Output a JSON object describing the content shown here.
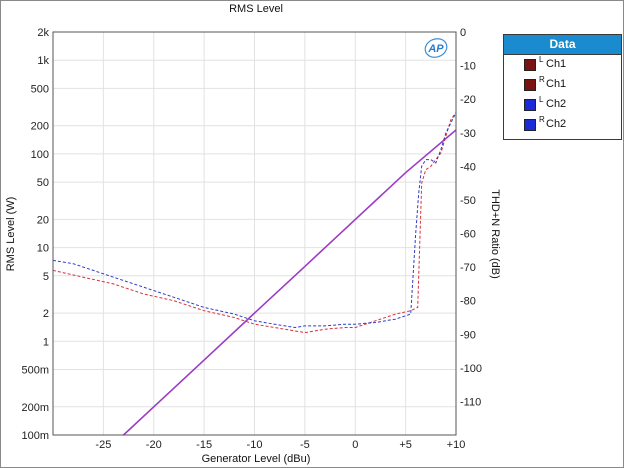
{
  "chart_data": {
    "type": "line",
    "title": "RMS Level",
    "xlabel": "Generator Level (dBu)",
    "ylabel": "RMS Level (W)",
    "y2label": "THD+N Ratio (dB)",
    "xlim": [
      -30,
      10
    ],
    "ylim": [
      0.1,
      2000
    ],
    "yscale": "log",
    "y2lim": [
      -120,
      0
    ],
    "x_ticks": [
      {
        "v": -25,
        "label": "-25"
      },
      {
        "v": -20,
        "label": "-20"
      },
      {
        "v": -15,
        "label": "-15"
      },
      {
        "v": -10,
        "label": "-10"
      },
      {
        "v": -5,
        "label": "-5"
      },
      {
        "v": 0,
        "label": "0"
      },
      {
        "v": 5,
        "label": "+5"
      },
      {
        "v": 10,
        "label": "+10"
      }
    ],
    "y_ticks": [
      {
        "v": 2000,
        "label": "2k"
      },
      {
        "v": 1000,
        "label": "1k"
      },
      {
        "v": 500,
        "label": "500"
      },
      {
        "v": 200,
        "label": "200"
      },
      {
        "v": 100,
        "label": "100"
      },
      {
        "v": 50,
        "label": "50"
      },
      {
        "v": 20,
        "label": "20"
      },
      {
        "v": 10,
        "label": "10"
      },
      {
        "v": 5,
        "label": "5"
      },
      {
        "v": 2,
        "label": "2"
      },
      {
        "v": 1,
        "label": "1"
      },
      {
        "v": 0.5,
        "label": "500m"
      },
      {
        "v": 0.2,
        "label": "200m"
      },
      {
        "v": 0.1,
        "label": "100m"
      }
    ],
    "y2_ticks": [
      {
        "v": 0,
        "label": "0"
      },
      {
        "v": -10,
        "label": "-10"
      },
      {
        "v": -20,
        "label": "-20"
      },
      {
        "v": -30,
        "label": "-30"
      },
      {
        "v": -40,
        "label": "-40"
      },
      {
        "v": -50,
        "label": "-50"
      },
      {
        "v": -60,
        "label": "-60"
      },
      {
        "v": -70,
        "label": "-70"
      },
      {
        "v": -80,
        "label": "-80"
      },
      {
        "v": -90,
        "label": "-90"
      },
      {
        "v": -100,
        "label": "-100"
      },
      {
        "v": -110,
        "label": "-110"
      }
    ],
    "grid": true,
    "legend": {
      "title": "Data",
      "position": "right",
      "items": [
        {
          "sup": "L",
          "name": "Ch1",
          "color": "#7a1212"
        },
        {
          "sup": "R",
          "name": "Ch1",
          "color": "#7a1212"
        },
        {
          "sup": "L",
          "name": "Ch2",
          "color": "#1a2ad8"
        },
        {
          "sup": "R",
          "name": "Ch2",
          "color": "#1a2ad8"
        }
      ]
    },
    "logo": "AP",
    "series": [
      {
        "axis": "left",
        "style": "solid",
        "color": "#9a3cc4",
        "x": [
          -23,
          -20,
          -15,
          -10,
          -5,
          0,
          5,
          10
        ],
        "y": [
          0.1,
          0.2,
          0.63,
          2.0,
          6.3,
          20,
          63,
          180
        ]
      },
      {
        "axis": "right",
        "style": "dashed",
        "color": "#d8303a",
        "x": [
          -30,
          -27,
          -24,
          -21,
          -18,
          -15,
          -12,
          -10,
          -8,
          -6,
          -5,
          -3,
          -1,
          0,
          2,
          4,
          5.5,
          6.2,
          6.6,
          7.0,
          7.5,
          8.0,
          8.5,
          9.0,
          9.5,
          10
        ],
        "y": [
          -71,
          -73,
          -75,
          -78,
          -80,
          -83,
          -85,
          -87,
          -88,
          -89,
          -89.5,
          -88.5,
          -88,
          -88,
          -86,
          -84,
          -83,
          -82,
          -45,
          -41,
          -40,
          -38,
          -36,
          -31,
          -26,
          -24
        ]
      },
      {
        "axis": "right",
        "style": "dashed",
        "color": "#2e3ccc",
        "x": [
          -30,
          -28,
          -26,
          -24,
          -21,
          -18,
          -15,
          -12,
          -10,
          -8,
          -6,
          -5,
          -3,
          -1,
          0,
          2,
          4,
          5.5,
          6.0,
          6.3,
          6.6,
          7.0,
          7.5,
          8.0,
          8.5,
          9.0,
          10
        ],
        "y": [
          -68,
          -69,
          -71,
          -73,
          -76,
          -79,
          -82,
          -84,
          -86,
          -87,
          -88,
          -87.5,
          -87.5,
          -87,
          -87,
          -86.5,
          -85.5,
          -84,
          -60,
          -48,
          -40,
          -38,
          -38,
          -39,
          -35,
          -30,
          -24
        ]
      }
    ]
  }
}
